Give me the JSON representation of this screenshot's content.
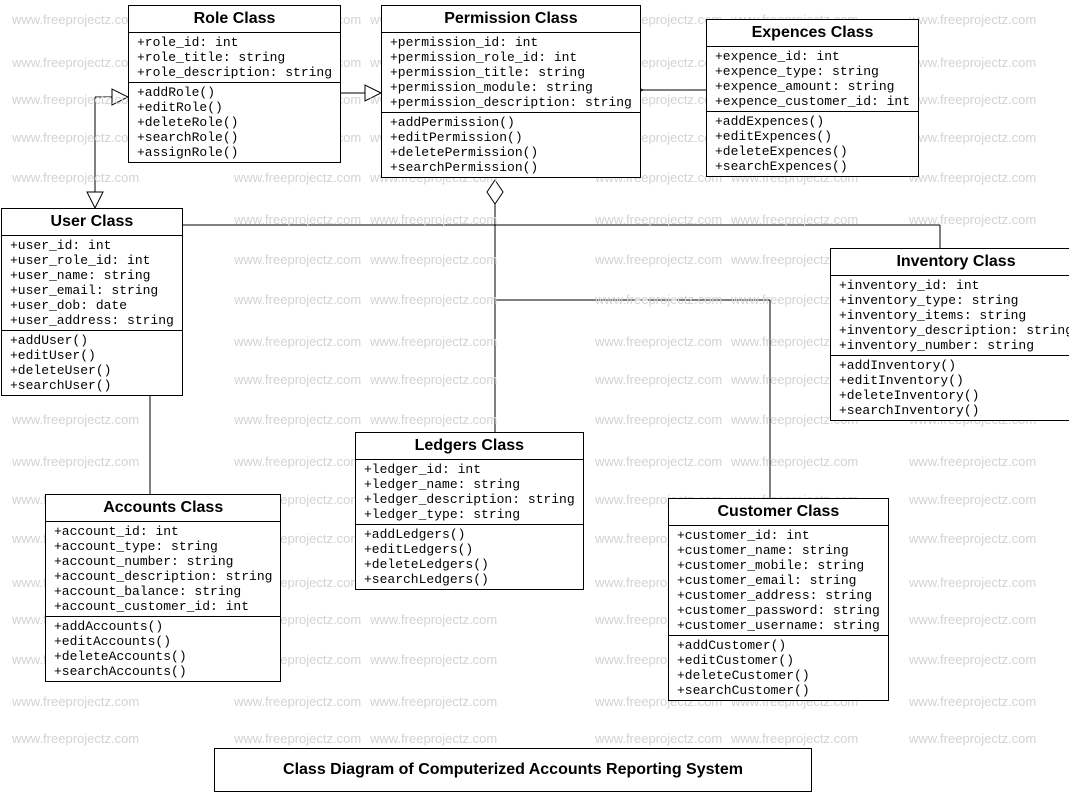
{
  "watermark": "www.freeprojectz.com",
  "diagram_title": "Class Diagram of Computerized Accounts Reporting System",
  "classes": {
    "role": {
      "title": "Role Class",
      "attrs": [
        "+role_id: int",
        "+role_title: string",
        "+role_description: string"
      ],
      "ops": [
        "+addRole()",
        "+editRole()",
        "+deleteRole()",
        "+searchRole()",
        "+assignRole()"
      ]
    },
    "permission": {
      "title": "Permission Class",
      "attrs": [
        "+permission_id: int",
        "+permission_role_id: int",
        "+permission_title: string",
        "+permission_module: string",
        "+permission_description: string"
      ],
      "ops": [
        "+addPermission()",
        "+editPermission()",
        "+deletePermission()",
        "+searchPermission()"
      ]
    },
    "expences": {
      "title": "Expences Class",
      "attrs": [
        "+expence_id: int",
        "+expence_type: string",
        "+expence_amount: string",
        "+expence_customer_id: int"
      ],
      "ops": [
        "+addExpences()",
        "+editExpences()",
        "+deleteExpences()",
        "+searchExpences()"
      ]
    },
    "user": {
      "title": "User Class",
      "attrs": [
        "+user_id: int",
        "+user_role_id: int",
        "+user_name: string",
        "+user_email: string",
        "+user_dob: date",
        "+user_address: string"
      ],
      "ops": [
        "+addUser()",
        "+editUser()",
        "+deleteUser()",
        "+searchUser()"
      ]
    },
    "inventory": {
      "title": "Inventory Class",
      "attrs": [
        "+inventory_id: int",
        "+inventory_type: string",
        "+inventory_items: string",
        "+inventory_description: string",
        "+inventory_number: string"
      ],
      "ops": [
        "+addInventory()",
        "+editInventory()",
        "+deleteInventory()",
        "+searchInventory()"
      ]
    },
    "ledgers": {
      "title": "Ledgers Class",
      "attrs": [
        "+ledger_id: int",
        "+ledger_name: string",
        "+ledger_description: string",
        "+ledger_type: string"
      ],
      "ops": [
        "+addLedgers()",
        "+editLedgers()",
        "+deleteLedgers()",
        "+searchLedgers()"
      ]
    },
    "accounts": {
      "title": "Accounts Class",
      "attrs": [
        "+account_id: int",
        "+account_type: string",
        "+account_number: string",
        "+account_description: string",
        "+account_balance: string",
        "+account_customer_id: int"
      ],
      "ops": [
        "+addAccounts()",
        "+editAccounts()",
        "+deleteAccounts()",
        "+searchAccounts()"
      ]
    },
    "customer": {
      "title": "Customer Class",
      "attrs": [
        "+customer_id: int",
        "+customer_name: string",
        "+customer_mobile: string",
        "+customer_email: string",
        "+customer_address: string",
        "+customer_password: string",
        "+customer_username: string"
      ],
      "ops": [
        "+addCustomer()",
        "+editCustomer()",
        "+deleteCustomer()",
        "+searchCustomer()"
      ]
    }
  }
}
